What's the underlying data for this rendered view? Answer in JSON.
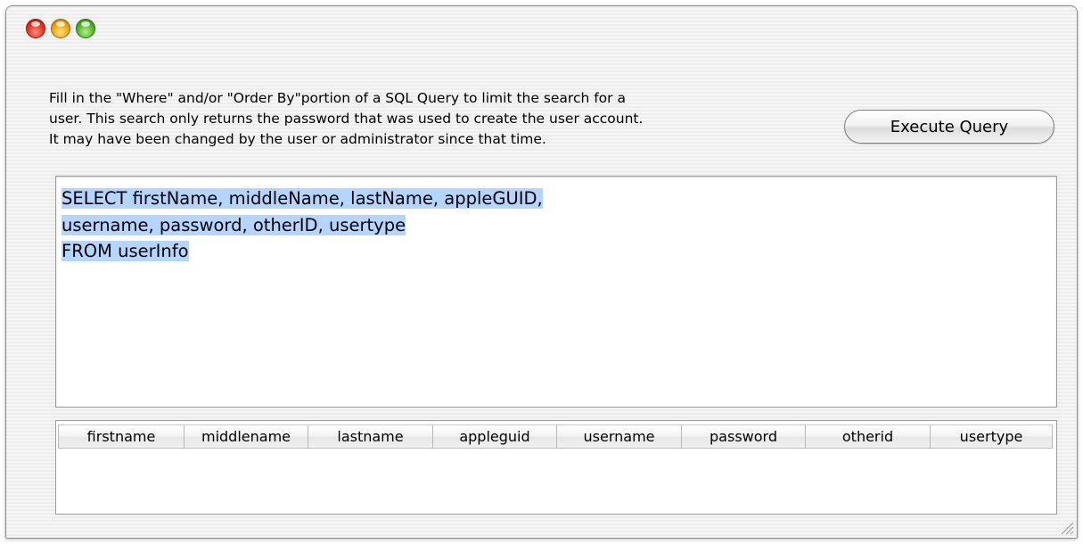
{
  "window": {
    "buttons": {
      "close_color": "#e0321f",
      "minimize_color": "#f2a20c",
      "zoom_color": "#4fb22a"
    }
  },
  "description": {
    "text": "Fill in the \"Where\" and/or \"Order By\"portion of a SQL Query to limit the search for a\nuser. This search only returns the password that was used to create the user account.\nIt may have been changed by the user or administrator since that time."
  },
  "execute_button": {
    "label": "Execute Query"
  },
  "query": {
    "lines": [
      "SELECT firstName, middleName, lastName, appleGUID,",
      "username, password, otherID, usertype",
      "FROM userInfo"
    ],
    "selection_color": "#b5d5ff"
  },
  "results": {
    "columns": [
      "firstname",
      "middlename",
      "lastname",
      "appleguid",
      "username",
      "password",
      "otherid",
      "usertype"
    ],
    "rows": []
  }
}
